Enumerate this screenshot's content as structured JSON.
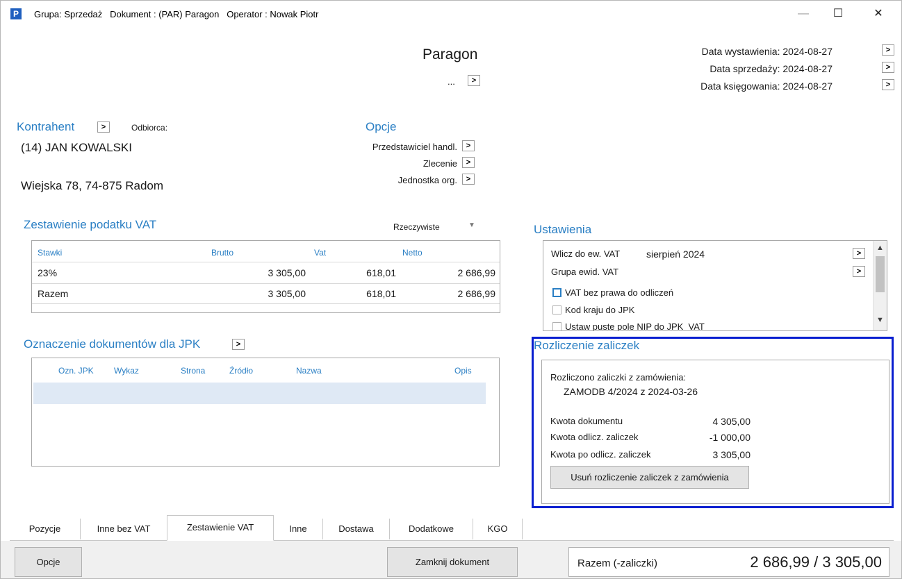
{
  "window": {
    "icon": "P",
    "title": "Grupa: Sprzedaż   Dokument : (PAR) Paragon   Operator : Nowak Piotr",
    "minimize": "—",
    "maximize": "☐",
    "close": "✕"
  },
  "header": {
    "doc_type": "Paragon",
    "doc_number": "...",
    "dates": [
      {
        "label": "Data wystawienia:",
        "value": "2024-08-27"
      },
      {
        "label": "Data sprzedaży:",
        "value": "2024-08-27"
      },
      {
        "label": "Data księgowania:",
        "value": "2024-08-27"
      }
    ]
  },
  "contractor": {
    "title": "Kontrahent",
    "recipient_label": "Odbiorca:",
    "name": "(14) JAN KOWALSKI",
    "address": "Wiejska 78, 74-875 Radom"
  },
  "options": {
    "title": "Opcje",
    "items": [
      "Przedstawiciel handl.",
      "Zlecenie",
      "Jednostka org."
    ]
  },
  "vat": {
    "title": "Zestawienie podatku VAT",
    "mode": "Rzeczywiste",
    "columns": [
      "Stawki",
      "Brutto",
      "Vat",
      "Netto"
    ],
    "rows": [
      {
        "rate": "23%",
        "gross": "3 305,00",
        "vat": "618,01",
        "net": "2 686,99"
      },
      {
        "rate": "Razem",
        "gross": "3 305,00",
        "vat": "618,01",
        "net": "2 686,99"
      }
    ]
  },
  "jpk": {
    "title": "Oznaczenie dokumentów dla JPK",
    "columns": [
      "Ozn. JPK",
      "Wykaz",
      "Strona",
      "Źródło",
      "Nazwa",
      "Opis"
    ]
  },
  "settings": {
    "title": "Ustawienia",
    "vat_register_label": "Wlicz do ew. VAT",
    "vat_register_value": "sierpień 2024",
    "vat_group_label": "Grupa ewid. VAT",
    "checkboxes": [
      "VAT bez prawa do odliczeń",
      "Kod kraju do JPK",
      "Ustaw puste pole NIP do JPK_VAT"
    ]
  },
  "advances": {
    "title": "Rozliczenie zaliczek",
    "settled_label": "Rozliczono zaliczki z zamówienia:",
    "order_ref": "ZAMODB 4/2024 z 2024-03-26",
    "rows": [
      {
        "label": "Kwota dokumentu",
        "value": "4 305,00"
      },
      {
        "label": "Kwota odlicz. zaliczek",
        "value": "-1 000,00"
      },
      {
        "label": "Kwota po odlicz. zaliczek",
        "value": "3 305,00"
      }
    ],
    "remove_button": "Usuń rozliczenie zaliczek z zamówienia",
    "highlight_color": "#0a1fd0"
  },
  "tabs": [
    "Pozycje",
    "Inne bez VAT",
    "Zestawienie VAT",
    "Inne",
    "Dostawa",
    "Dodatkowe",
    "KGO"
  ],
  "footer": {
    "options_button": "Opcje",
    "close_doc_button": "Zamknij dokument",
    "total_label": "Razem  (-zaliczki)",
    "total_value": "2 686,99 / 3 305,00"
  },
  "colors": {
    "accent": "#2a7fc4",
    "selected_row": "#dfe9f5"
  }
}
